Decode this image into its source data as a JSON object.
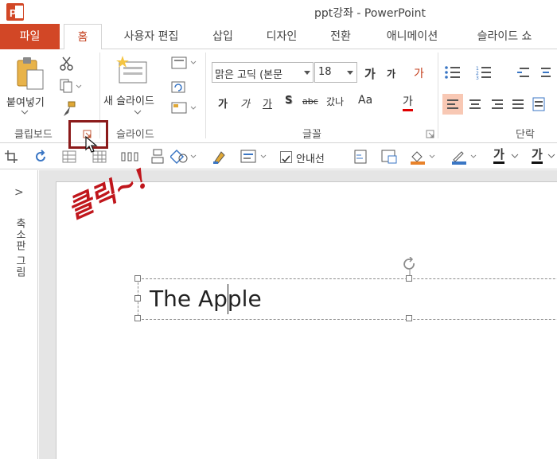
{
  "window": {
    "title": "ppt강좌 - PowerPoint"
  },
  "tabs": [
    {
      "label": "파일"
    },
    {
      "label": "홈"
    },
    {
      "label": "사용자 편집"
    },
    {
      "label": "삽입"
    },
    {
      "label": "디자인"
    },
    {
      "label": "전환"
    },
    {
      "label": "애니메이션"
    },
    {
      "label": "슬라이드 쇼"
    }
  ],
  "ribbon": {
    "clipboard": {
      "paste_label": "붙여넣기",
      "group_label": "클립보드"
    },
    "slides": {
      "new_slide_label": "새 슬라이드",
      "group_label": "슬라이드"
    },
    "font": {
      "font_name": "맑은 고딕 (본문",
      "font_size": "18",
      "group_label": "글꼴",
      "bold": "가",
      "italic": "가",
      "underline": "가",
      "shadow": "S",
      "strike": "abc",
      "spacing": "갔나",
      "case": "Aa",
      "grow": "가",
      "shrink": "가",
      "clear": "가",
      "color": "가"
    },
    "paragraph": {
      "group_label": "단락"
    }
  },
  "qat": {
    "guide_label": "안내선",
    "text_style_1": "가",
    "text_style_2": "가"
  },
  "thumbnail_pane": {
    "label": "축소판 그림",
    "expand": ">"
  },
  "slide": {
    "text": "The Apple"
  },
  "annotation": {
    "text": "클릭~!"
  },
  "colors": {
    "accent": "#d24726",
    "home_tab": "#c43e1c",
    "highlight": "#8b1a1a",
    "annotation": "#c0161c"
  }
}
